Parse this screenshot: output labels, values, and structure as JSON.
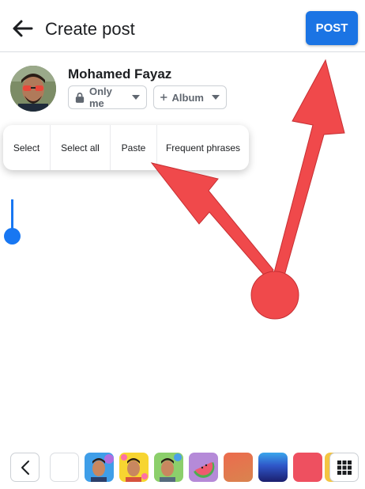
{
  "header": {
    "back_icon": "arrow-left-icon",
    "title": "Create post",
    "post_label": "POST",
    "accent": "#1b74e4"
  },
  "profile": {
    "name": "Mohamed Fayaz",
    "privacy_label": "Only me",
    "privacy_icon": "lock-icon",
    "album_label": "Album",
    "album_icon": "plus-icon"
  },
  "context_menu": {
    "items": [
      "Select",
      "Select all",
      "Paste",
      "Frequent phrases"
    ]
  },
  "annotation": {
    "color": "#f0494b"
  },
  "background_bar": {
    "back_icon": "chevron-left-icon",
    "grid_icon": "grid-icon",
    "swatches": [
      {
        "name": "white",
        "color": "#ffffff"
      },
      {
        "name": "avatar-blue",
        "color": "#3f9ee8"
      },
      {
        "name": "avatar-yellow",
        "color": "#f7d531"
      },
      {
        "name": "avatar-green",
        "color": "#8ccf6b"
      },
      {
        "name": "watermelon",
        "color": "#b58ad8"
      },
      {
        "name": "orange-gradient",
        "color": "#e0704a"
      },
      {
        "name": "blue-gradient",
        "color": "#2f56c8"
      },
      {
        "name": "red",
        "color": "#ee5060"
      },
      {
        "name": "yellow-partial",
        "color": "#f4c542"
      }
    ]
  }
}
